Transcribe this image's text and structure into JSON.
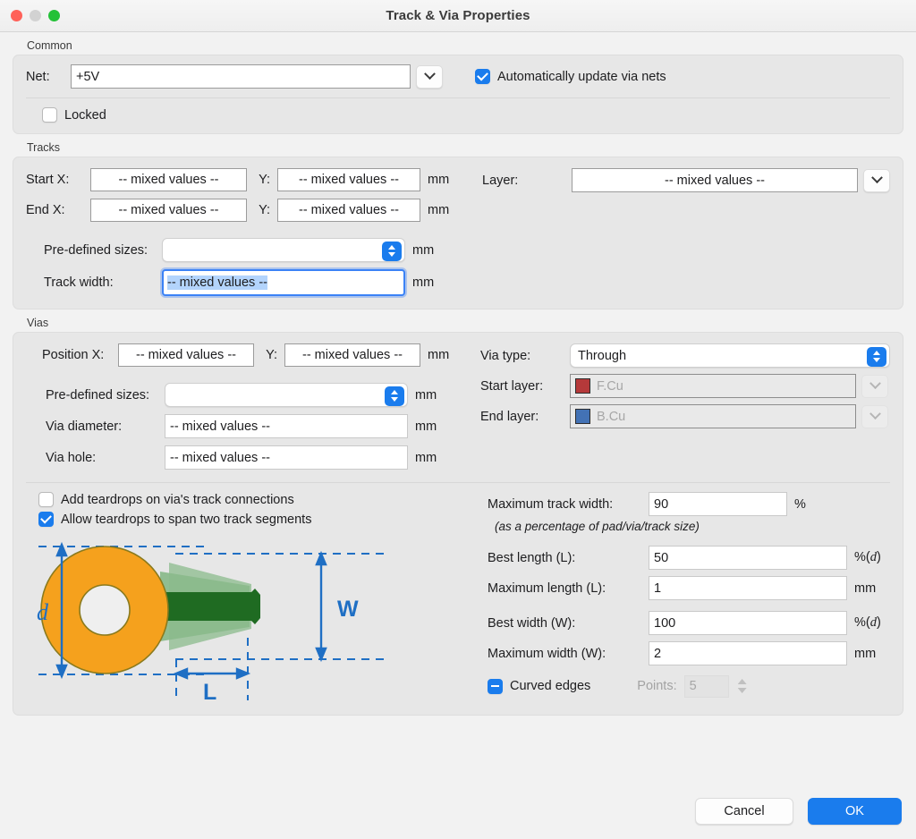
{
  "window": {
    "title": "Track & Via Properties",
    "traffic_lights": [
      "close-button",
      "minimize-button",
      "zoom-button"
    ]
  },
  "common": {
    "group_label": "Common",
    "net_label": "Net:",
    "net_value": "+5V",
    "auto_update_label": "Automatically update via nets",
    "auto_update_checked": true,
    "locked_label": "Locked",
    "locked_checked": false
  },
  "tracks": {
    "group_label": "Tracks",
    "start_x_label": "Start X:",
    "start_x_value": "-- mixed values --",
    "start_y_label": "Y:",
    "start_y_value": "-- mixed values --",
    "start_unit": "mm",
    "end_x_label": "End X:",
    "end_x_value": "-- mixed values --",
    "end_y_label": "Y:",
    "end_y_value": "-- mixed values --",
    "end_unit": "mm",
    "predefined_label": "Pre-defined sizes:",
    "predefined_value": "",
    "predefined_unit": "mm",
    "track_width_label": "Track width:",
    "track_width_value": "-- mixed values --",
    "track_width_unit": "mm",
    "layer_label": "Layer:",
    "layer_value": "-- mixed values --"
  },
  "vias": {
    "group_label": "Vias",
    "position_x_label": "Position X:",
    "position_x_value": "-- mixed values --",
    "position_y_label": "Y:",
    "position_y_value": "-- mixed values --",
    "position_unit": "mm",
    "predefined_label": "Pre-defined sizes:",
    "predefined_value": "",
    "predefined_unit": "mm",
    "via_diameter_label": "Via diameter:",
    "via_diameter_value": "-- mixed values --",
    "via_diameter_unit": "mm",
    "via_hole_label": "Via hole:",
    "via_hole_value": "-- mixed values --",
    "via_hole_unit": "mm",
    "via_type_label": "Via type:",
    "via_type_value": "Through",
    "start_layer_label": "Start layer:",
    "start_layer_value": "F.Cu",
    "start_layer_color": "#b5393a",
    "end_layer_label": "End layer:",
    "end_layer_value": "B.Cu",
    "end_layer_color": "#4372b5"
  },
  "teardrops": {
    "add_teardrops_label": "Add teardrops on via's track connections",
    "add_teardrops_checked": false,
    "span_two_segments_label": "Allow teardrops to span two track segments",
    "span_two_segments_checked": true,
    "max_track_width_label": "Maximum track width:",
    "max_track_width_value": "90",
    "max_track_width_unit": "%",
    "percentage_note": "(as a percentage of pad/via/track size)",
    "best_length_label": "Best length (L):",
    "best_length_value": "50",
    "best_length_unit": "%(d)",
    "max_length_label": "Maximum length (L):",
    "max_length_value": "1",
    "max_length_unit": "mm",
    "best_width_label": "Best width (W):",
    "best_width_value": "100",
    "best_width_unit": "%(d)",
    "max_width_label": "Maximum width (W):",
    "max_width_value": "2",
    "max_width_unit": "mm",
    "curved_edges_label": "Curved edges",
    "curved_edges_state": "mixed",
    "points_label": "Points:",
    "points_value": "5",
    "diagram": {
      "label_d": "d",
      "label_w": "W",
      "label_l": "L",
      "pad_color": "#f5a11d",
      "track_color": "#1f6b22",
      "teardrop_color": "#6aa96b",
      "dimension_color": "#1f6fc4"
    }
  },
  "footer": {
    "cancel_label": "Cancel",
    "ok_label": "OK"
  }
}
